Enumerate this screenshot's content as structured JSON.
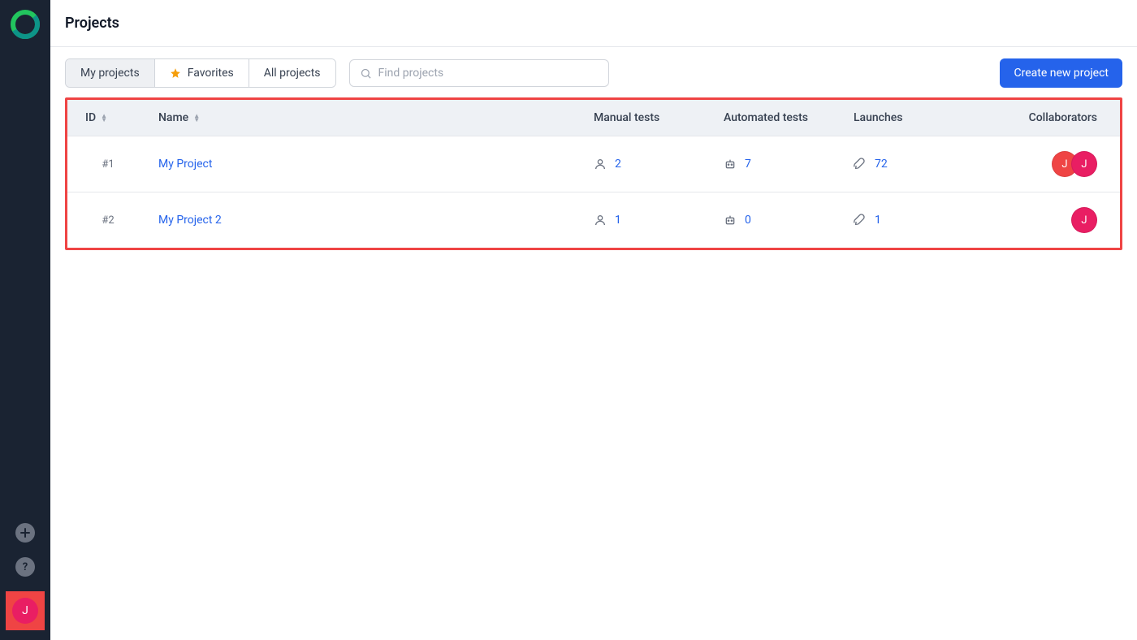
{
  "page": {
    "title": "Projects"
  },
  "sidebar": {
    "user_initial": "J"
  },
  "toolbar": {
    "tabs": [
      {
        "label": "My projects",
        "active": true
      },
      {
        "label": "Favorites",
        "active": false
      },
      {
        "label": "All projects",
        "active": false
      }
    ],
    "search_placeholder": "Find projects",
    "create_label": "Create new project"
  },
  "table": {
    "columns": {
      "id": "ID",
      "name": "Name",
      "manual": "Manual tests",
      "auto": "Automated tests",
      "launches": "Launches",
      "collab": "Collaborators"
    },
    "rows": [
      {
        "id": "#1",
        "name": "My Project",
        "manual": "2",
        "auto": "7",
        "launches": "72",
        "collaborators": [
          {
            "initial": "J",
            "color": "av-red"
          },
          {
            "initial": "J",
            "color": "av-pink"
          }
        ]
      },
      {
        "id": "#2",
        "name": "My Project 2",
        "manual": "1",
        "auto": "0",
        "launches": "1",
        "collaborators": [
          {
            "initial": "J",
            "color": "av-pink"
          }
        ]
      }
    ]
  }
}
